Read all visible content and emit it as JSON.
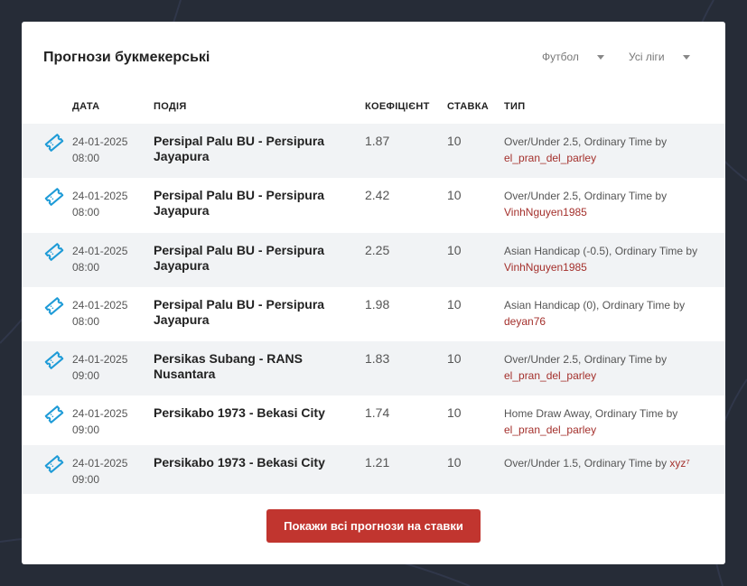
{
  "widget": {
    "title": "Прогнози букмекерські",
    "filters": {
      "sport": "Футбол",
      "league": "Усі ліги"
    },
    "columns": {
      "date": "ДАТА",
      "event": "ПОДІЯ",
      "odds": "КОЕФІЦІЄНТ",
      "stake": "СТАВКА",
      "type": "ТИП"
    },
    "rows": [
      {
        "date": "24-01-2025",
        "time": "08:00",
        "event": "Persipal Palu BU - Persipura Jayapura",
        "odds": "1.87",
        "stake": "10",
        "type": "Over/Under 2.5, Ordinary Time by",
        "user": "el_pran_del_parley"
      },
      {
        "date": "24-01-2025",
        "time": "08:00",
        "event": "Persipal Palu BU - Persipura Jayapura",
        "odds": "2.42",
        "stake": "10",
        "type": "Over/Under 2.5, Ordinary Time by",
        "user": "VinhNguyen1985"
      },
      {
        "date": "24-01-2025",
        "time": "08:00",
        "event": "Persipal Palu BU - Persipura Jayapura",
        "odds": "2.25",
        "stake": "10",
        "type": "Asian Handicap (-0.5), Ordinary Time by",
        "user": "VinhNguyen1985"
      },
      {
        "date": "24-01-2025",
        "time": "08:00",
        "event": "Persipal Palu BU - Persipura Jayapura",
        "odds": "1.98",
        "stake": "10",
        "type": "Asian Handicap (0), Ordinary Time by",
        "user": "deyan76"
      },
      {
        "date": "24-01-2025",
        "time": "09:00",
        "event": "Persikas Subang - RANS Nusantara",
        "odds": "1.83",
        "stake": "10",
        "type": "Over/Under 2.5, Ordinary Time by",
        "user": "el_pran_del_parley"
      },
      {
        "date": "24-01-2025",
        "time": "09:00",
        "event": "Persikabo 1973 - Bekasi City",
        "odds": "1.74",
        "stake": "10",
        "type": "Home Draw Away, Ordinary Time by",
        "user": "el_pran_del_parley"
      },
      {
        "date": "24-01-2025",
        "time": "09:00",
        "event": "Persikabo 1973 - Bekasi City",
        "odds": "1.21",
        "stake": "10",
        "type": "Over/Under 1.5, Ordinary Time by",
        "user": "xyz⁷"
      }
    ],
    "cta_label": "Покажи всі прогнози на ставки",
    "colors": {
      "accent": "#c1352f",
      "ticket_icon": "#1e9bd7",
      "username": "#a4302c",
      "row_alt": "#f1f3f5",
      "page_bg": "#262c37"
    },
    "icons": {
      "row_icon": "ticket-icon",
      "dropdown": "caret-down-icon"
    }
  }
}
